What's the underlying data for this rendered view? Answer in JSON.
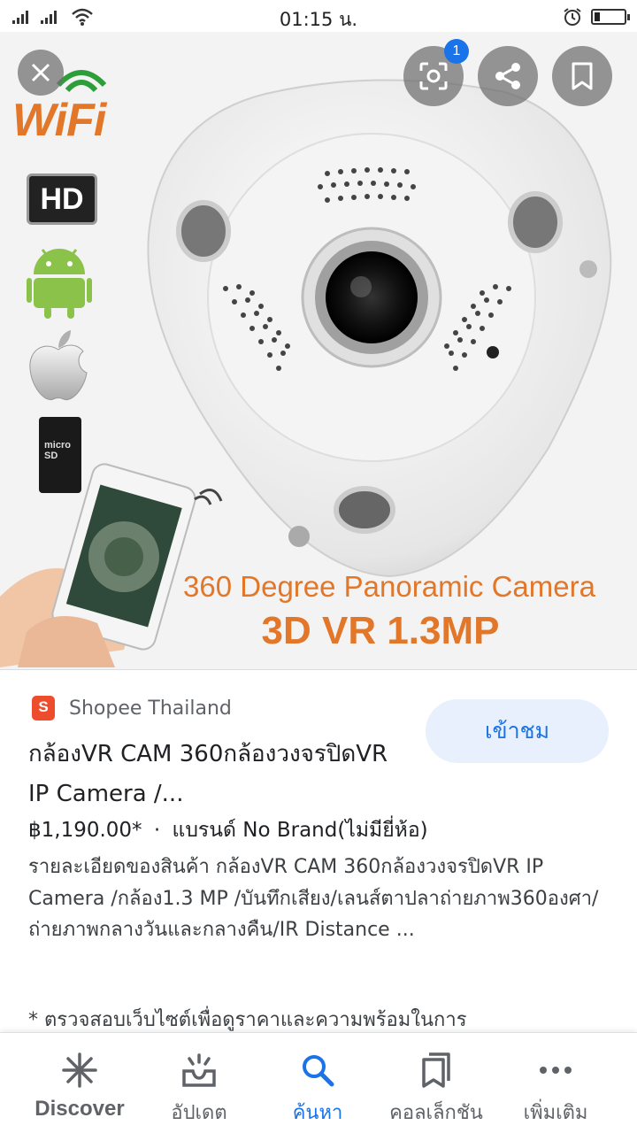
{
  "status_bar": {
    "time": "01:15 น.",
    "battery_level": 0.2
  },
  "image": {
    "brand_word": "WiFi",
    "hd_badge": "HD",
    "sd_label": "micro SD",
    "caption_line1": "360 Degree Panoramic Camera",
    "caption_line2": "3D VR 1.3MP",
    "lens_badge_count": "1"
  },
  "result": {
    "source": "Shopee Thailand",
    "source_logo_letter": "S",
    "title": "กล้องVR CAM 360กล้องวงจรปิดVR IP Camera /...",
    "price": "฿1,190.00*",
    "separator": "·",
    "brand": "แบรนด์ No Brand(ไม่มียี่ห้อ)",
    "description": "รายละเอียดของสินค้า กล้องVR CAM 360กล้องวงจรปิดVR IP Camera /กล้อง1.3 MP /บันทึกเสียง/เลนส์ตาปลาถ่ายภาพ360องศา/ถ่ายภาพกลางวันและกลางคืน/IR Distance ...",
    "disclaimer": "* ตรวจสอบเว็บไซต์เพื่อดูราคาและความพร้อมในการ",
    "visit_label": "เข้าชม"
  },
  "bottom_nav": {
    "items": [
      {
        "label": "Discover",
        "icon": "asterisk-icon"
      },
      {
        "label": "อัปเดต",
        "icon": "updates-icon"
      },
      {
        "label": "ค้นหา",
        "icon": "search-icon"
      },
      {
        "label": "คอลเล็กชัน",
        "icon": "collections-icon"
      },
      {
        "label": "เพิ่มเติม",
        "icon": "more-icon"
      }
    ],
    "active_index": 2
  },
  "colors": {
    "accent": "#1a73e8",
    "visit_bg": "#e8f0fe",
    "shopee": "#ee4d2d",
    "caption": "#e2772a"
  }
}
